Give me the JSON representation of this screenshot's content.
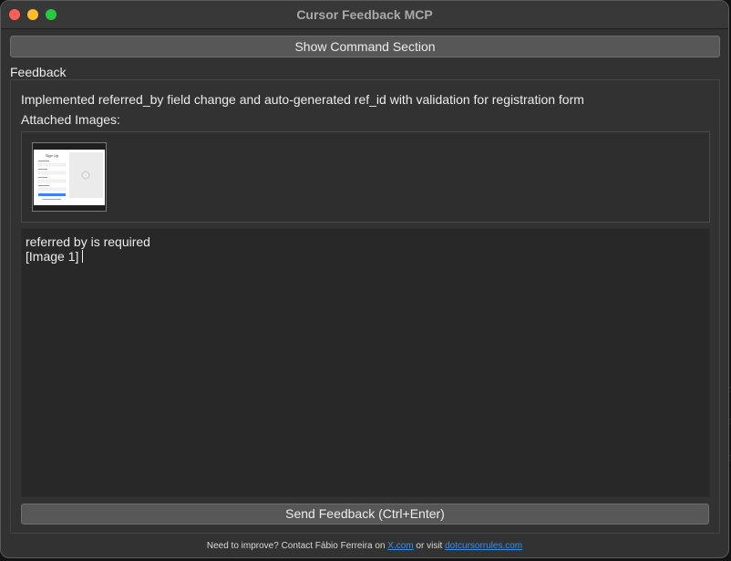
{
  "window": {
    "title": "Cursor Feedback MCP"
  },
  "toolbar": {
    "show_command_label": "Show Command Section"
  },
  "feedback": {
    "section_label": "Feedback",
    "summary": "Implemented referred_by field change and auto-generated ref_id with validation for registration form",
    "attached_images_label": "Attached Images:",
    "thumb": {
      "title": "Sign Up"
    },
    "text_lines": [
      "referred by is required",
      "[Image 1]"
    ],
    "send_label": "Send Feedback (Ctrl+Enter)"
  },
  "footer": {
    "prefix": "Need to improve? Contact Fábio Ferreira on",
    "link1": "X.com",
    "middle": "or visit",
    "link2": "dotcursorrules.com"
  },
  "colors": {
    "window_bg": "#323232",
    "titlebar_bg": "#383838",
    "button_bg": "#575757",
    "input_bg": "#282828",
    "link": "#3b8eea",
    "close": "#fe5f57",
    "minimize": "#febc2e",
    "zoom": "#28c840"
  }
}
